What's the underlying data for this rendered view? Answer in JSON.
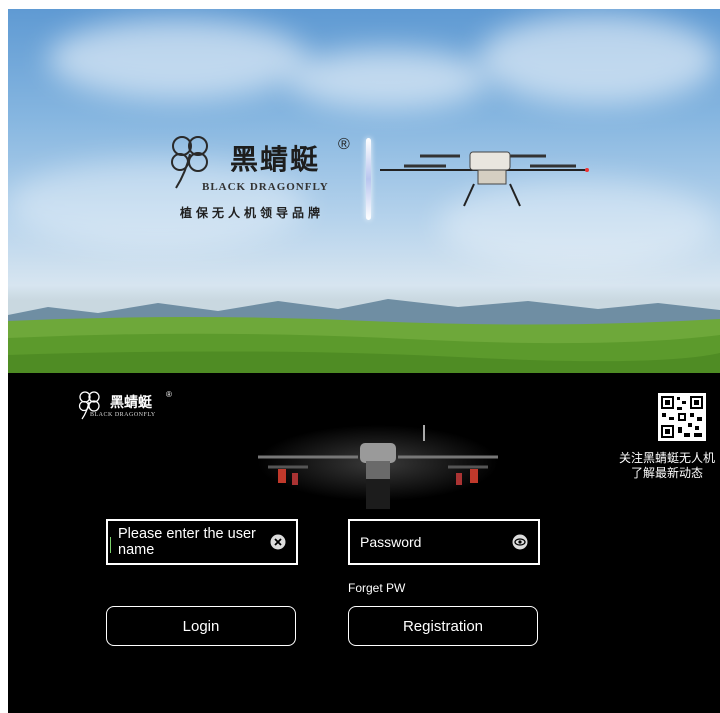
{
  "hero": {
    "brand_cn": "黑蜻蜓",
    "brand_reg": "®",
    "brand_en": "BLACK DRAGONFLY",
    "slogan": "植保无人机领导品牌"
  },
  "login": {
    "logo_cn": "黑蜻蜓",
    "logo_reg": "®",
    "logo_en": "BLACK DRAGONFLY",
    "qr_caption_line1": "关注黑蜻蜓无人机",
    "qr_caption_line2": "了解最新动态",
    "username_placeholder": "Please enter the user name",
    "password_placeholder": "Password",
    "forget_label": "Forget PW",
    "login_label": "Login",
    "register_label": "Registration"
  },
  "icons": {
    "clear": "clear-circle-icon",
    "eye": "eye-icon",
    "qr": "qr-code-icon"
  }
}
